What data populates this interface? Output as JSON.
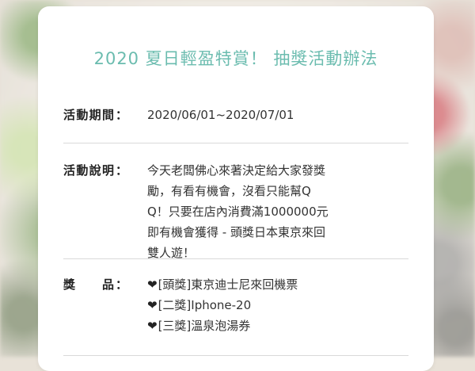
{
  "page": {
    "title": "2020 夏日輕盈特賞！ 抽獎活動辦法",
    "accent_color": "#6bbcaf"
  },
  "period": {
    "label": "活動期間",
    "colon": "：",
    "value": "2020/06/01~2020/07/01"
  },
  "description": {
    "label": "活動說明",
    "colon": "：",
    "value": "今天老闆佛心來著決定給大家發獎勵，有看有機會，沒看只能幫QQ！只要在店內消費滿1000000元即有機會獲得 - 頭獎日本東京來回雙人遊！"
  },
  "prizes": {
    "label": "獎　品",
    "colon": "：",
    "icon": "heart-icon",
    "items": [
      "[頭獎]東京迪士尼來回機票",
      "[二獎]Iphone-20",
      "[三獎]溫泉泡湯券"
    ]
  }
}
